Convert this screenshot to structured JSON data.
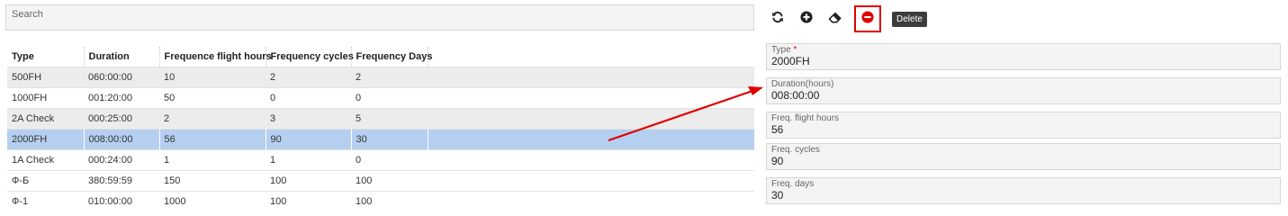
{
  "search": {
    "placeholder": "Search"
  },
  "table": {
    "columns": [
      "Type",
      "Duration",
      "Frequence flight hours",
      "Frequency cycles",
      "Frequency Days"
    ],
    "rows": [
      [
        "500FH",
        "060:00:00",
        "10",
        "2",
        "2"
      ],
      [
        "1000FH",
        "001:20:00",
        "50",
        "0",
        "0"
      ],
      [
        "2A Check",
        "000:25:00",
        "2",
        "3",
        "5"
      ],
      [
        "2000FH",
        "008:00:00",
        "56",
        "90",
        "30"
      ],
      [
        "1A Check",
        "000:24:00",
        "1",
        "1",
        "0"
      ],
      [
        "Ф-Б",
        "380:59:59",
        "150",
        "100",
        "100"
      ],
      [
        "Ф-1",
        "010:00:00",
        "1000",
        "100",
        "100"
      ]
    ],
    "selected_row": 3
  },
  "toolbar": {
    "refresh_icon": "refresh-icon",
    "add_icon": "plus-circle-icon",
    "eraser_icon": "eraser-icon",
    "delete_icon": "minus-circle-icon",
    "delete_tooltip": "Delete",
    "highlight_color": "#e00000"
  },
  "form": {
    "type_label": "Type",
    "type_required": "*",
    "type_value": "2000FH",
    "duration_label": "Duration(hours)",
    "duration_value": "008:00:00",
    "flight_hours_label": "Freq. flight hours",
    "flight_hours_value": "56",
    "cycles_label": "Freq. cycles",
    "cycles_value": "90",
    "days_label": "Freq. days",
    "days_value": "30"
  },
  "colors": {
    "selected_row": "#b5cff0",
    "alt_row": "#ececec",
    "annotation_arrow": "#e00000"
  }
}
